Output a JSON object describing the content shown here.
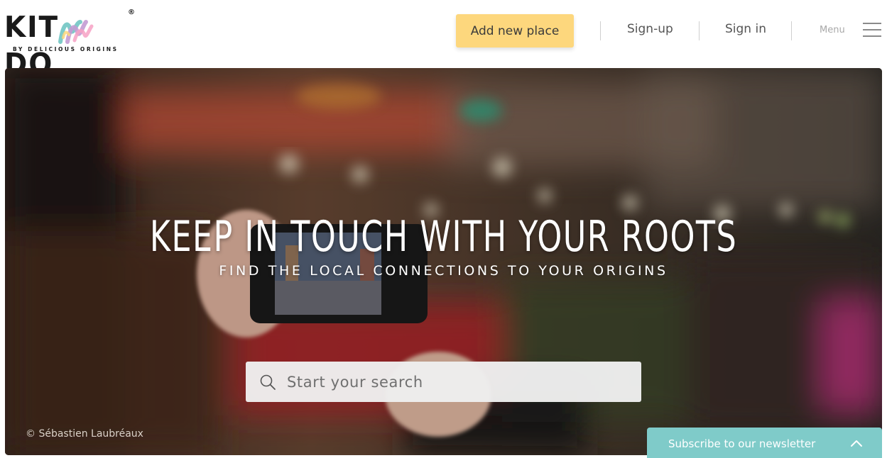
{
  "brand": {
    "name_left": "KIT",
    "name_right": "DO",
    "registered": "®",
    "tagline": "BY DELICIOUS ORIGINS"
  },
  "nav": {
    "add_place": "Add new place",
    "signup": "Sign-up",
    "signin": "Sign in",
    "menu": "Menu"
  },
  "hero": {
    "title": "KEEP IN TOUCH WITH YOUR ROOTS",
    "subtitle": "FIND THE LOCAL CONNECTIONS TO YOUR ORIGINS",
    "search_placeholder": "Start your search",
    "photo_credit": "© Sébastien Laubréaux"
  },
  "newsletter": {
    "label": "Subscribe to our newsletter"
  },
  "colors": {
    "accent_yellow": "#fdd77d",
    "newsletter_teal": "#7fcbc9",
    "logo_text": "#1a1a1a"
  },
  "icons": {
    "search": "search-icon",
    "menu": "hamburger-icon",
    "newsletter_toggle": "chevron-up-icon"
  }
}
